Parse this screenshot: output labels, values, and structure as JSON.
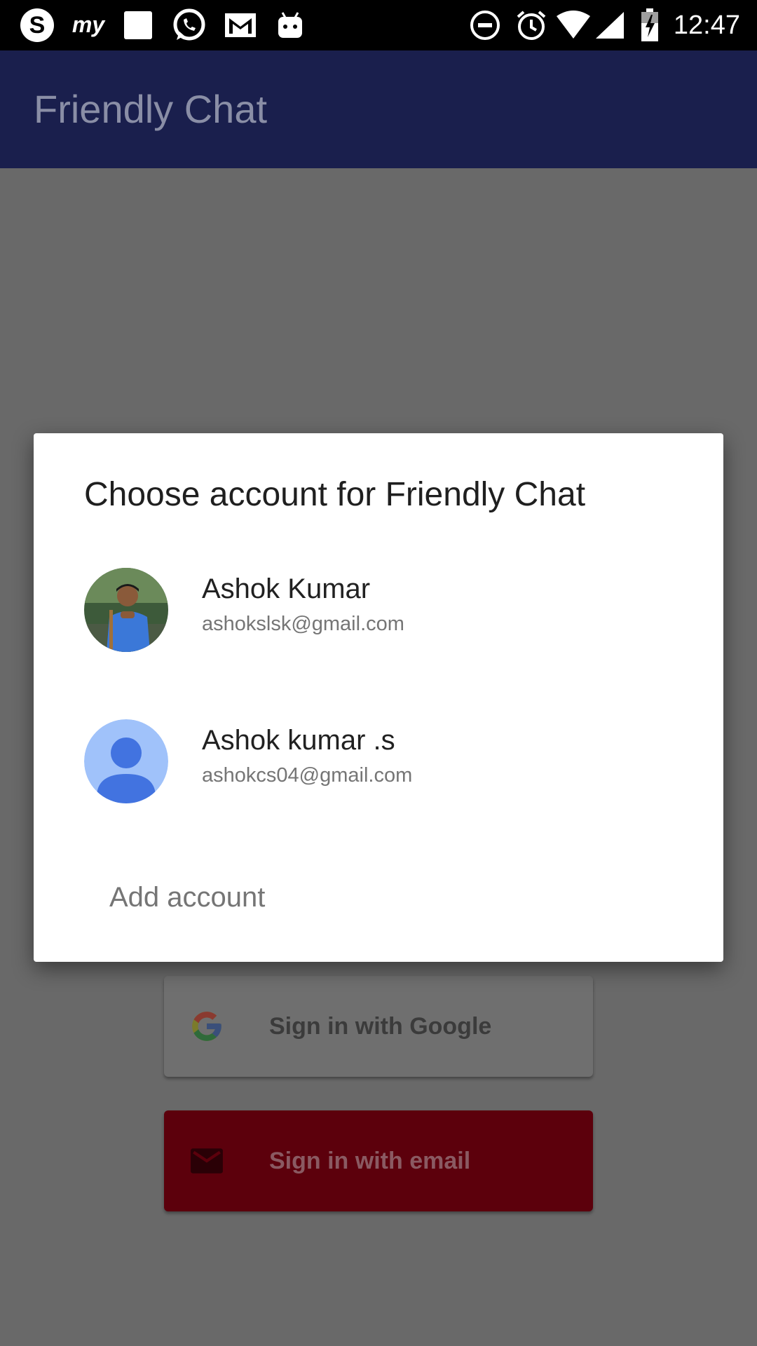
{
  "status_bar": {
    "time": "12:47",
    "left_icons": [
      "skype-icon",
      "myntra-icon",
      "image-icon",
      "whatsapp-icon",
      "gmail-icon",
      "android-icon"
    ],
    "right_icons": [
      "do-not-disturb-icon",
      "alarm-icon",
      "wifi-icon",
      "cell-signal-icon",
      "battery-charging-icon"
    ]
  },
  "app": {
    "title": "Friendly Chat",
    "google_button_label": "Sign in with Google",
    "email_button_label": "Sign in with email",
    "colors": {
      "app_bar": "#1a1f4d",
      "email_button": "#5c000c",
      "scrim": "#696969"
    }
  },
  "dialog": {
    "title": "Choose account for Friendly Chat",
    "accounts": [
      {
        "name": "Ashok Kumar",
        "email": "ashokslsk@gmail.com",
        "avatar": "photo-avatar"
      },
      {
        "name": "Ashok kumar .s",
        "email": "ashokcs04@gmail.com",
        "avatar": "default-person-avatar"
      }
    ],
    "add_account_label": "Add account"
  }
}
